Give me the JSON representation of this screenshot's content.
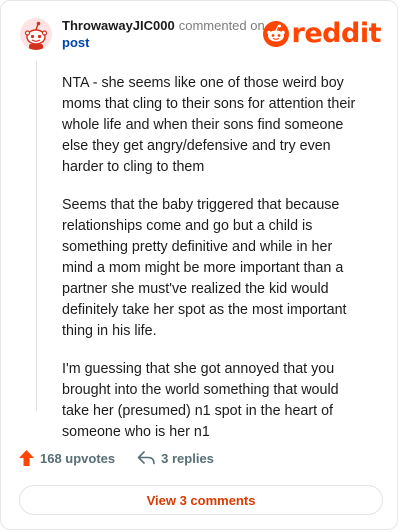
{
  "comment": {
    "author": "ThrowawayJIC000",
    "action_text": "commented on",
    "post_link": "post",
    "paragraphs": [
      "NTA - she seems like one of those weird boy moms that cling to their sons for attention their whole life and when their sons find someone else they get angry/defensive and try even harder to cling to them",
      "Seems that the baby triggered that because relationships come and go but a child is something pretty definitive and while in her mind a mom might be more important than a partner she must've realized the kid would definitely take her spot as the most important thing in his life.",
      "I'm guessing that she got annoyed that you brought into the world something that would take her (presumed) n1 spot in the heart of someone who is her n1"
    ],
    "upvotes": "168 upvotes",
    "replies": "3 replies",
    "view_comments": "View 3 comments"
  },
  "brand": {
    "name": "reddit",
    "accent_color": "#ff4500"
  },
  "icons": {
    "avatar": "snoo-avatar",
    "logo": "reddit-snoo-icon",
    "upvote": "upvote-arrow-icon",
    "reply": "reply-arrow-icon"
  }
}
